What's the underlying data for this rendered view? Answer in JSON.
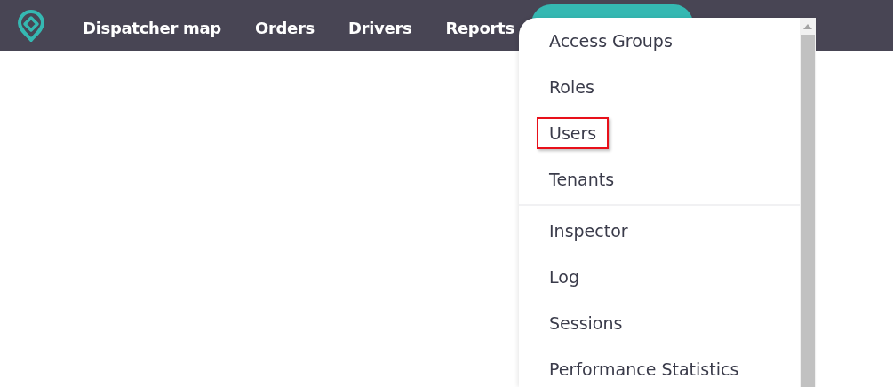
{
  "nav": {
    "items": [
      {
        "label": "Dispatcher map",
        "selected": false
      },
      {
        "label": "Orders",
        "selected": false
      },
      {
        "label": "Drivers",
        "selected": false
      },
      {
        "label": "Reports",
        "selected": false
      },
      {
        "selected": true
      }
    ]
  },
  "dropdown": {
    "groups": [
      {
        "items": [
          {
            "label": "Access Groups",
            "highlighted": false
          },
          {
            "label": "Roles",
            "highlighted": false
          },
          {
            "label": "Users",
            "highlighted": true
          },
          {
            "label": "Tenants",
            "highlighted": false
          }
        ]
      },
      {
        "items": [
          {
            "label": "Inspector",
            "highlighted": false
          },
          {
            "label": "Log",
            "highlighted": false
          },
          {
            "label": "Sessions",
            "highlighted": false
          },
          {
            "label": "Performance Statistics",
            "highlighted": false
          }
        ]
      }
    ]
  }
}
